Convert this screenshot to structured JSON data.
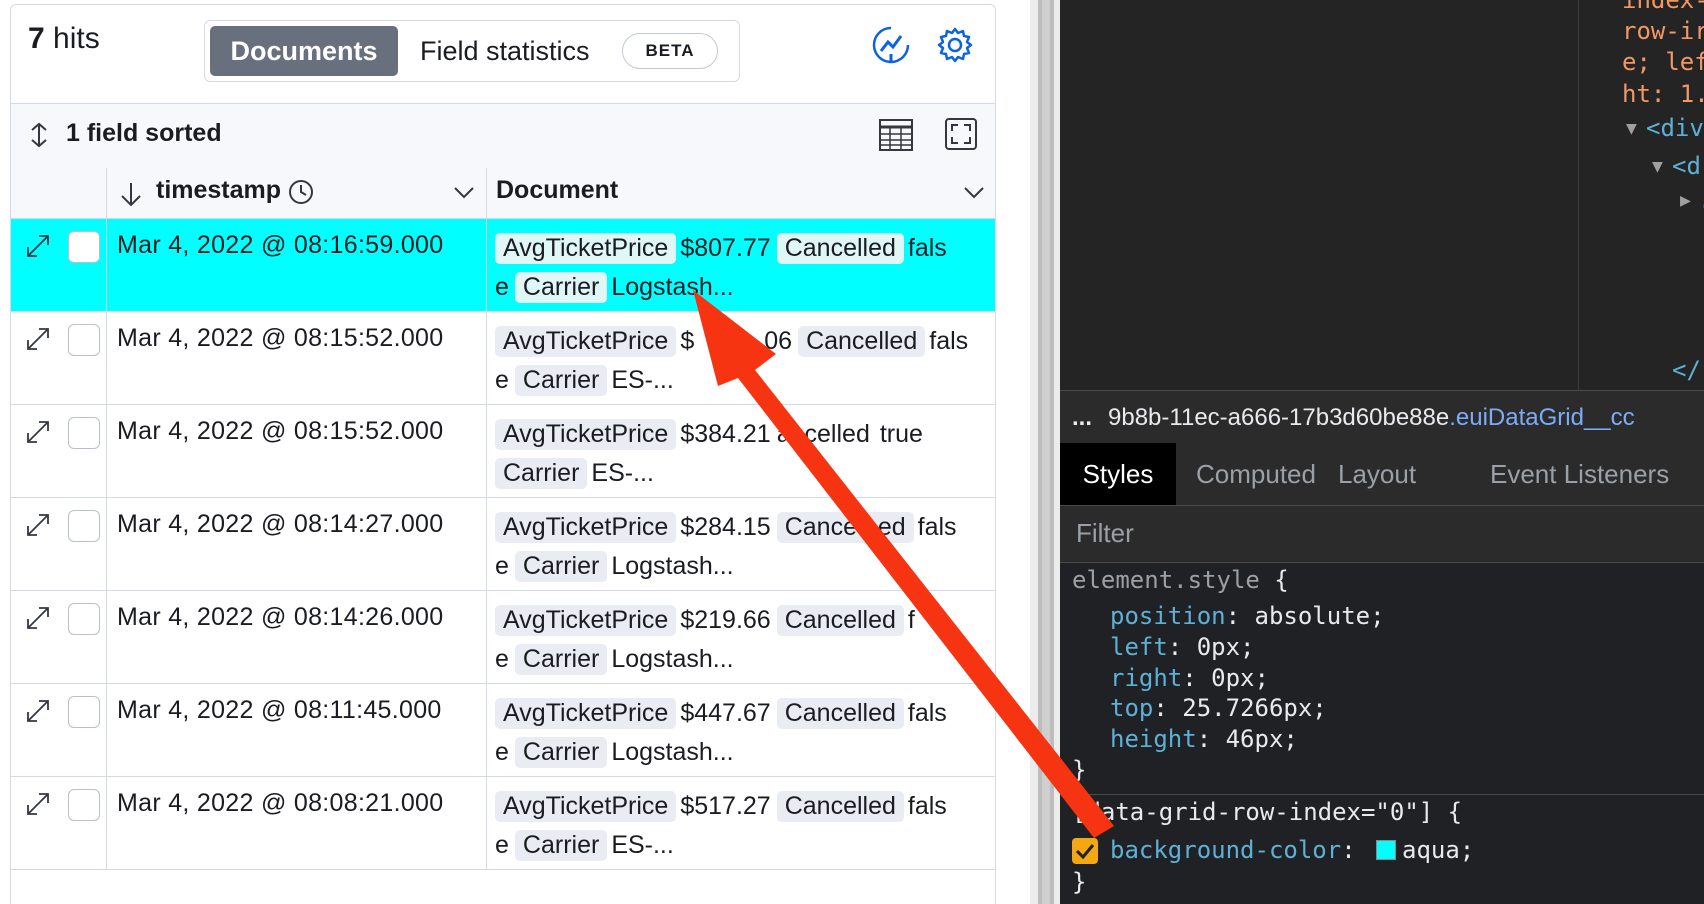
{
  "discover": {
    "hits_count": "7",
    "hits_label": "hits",
    "tabs": {
      "documents": "Documents",
      "field_statistics": "Field statistics",
      "beta": "BETA"
    },
    "toolbar": {
      "sort_label": "1 field sorted"
    },
    "columns": {
      "timestamp": "timestamp",
      "document": "Document"
    },
    "rows": [
      {
        "timestamp": "Mar 4, 2022 @ 08:16:59.000",
        "f1": "AvgTicketPrice",
        "v1": "$807.77",
        "f2": "Cancelled",
        "v2a": "fals",
        "v2b": "e",
        "f3": "Carrier",
        "v3": "Logstash...",
        "highlighted": true
      },
      {
        "timestamp": "Mar 4, 2022 @ 08:15:52.000",
        "f1": "AvgTicketPrice",
        "v1": "$",
        "v1b": "06",
        "f2": "Cancelled",
        "v2a": "fals",
        "v2b": "e",
        "f3": "Carrier",
        "v3": "ES-..."
      },
      {
        "timestamp": "Mar 4, 2022 @ 08:15:52.000",
        "f1": "AvgTicketPrice",
        "v1": "$384.21",
        "f2": "ancelled",
        "v2a": "true",
        "v2b": "",
        "f3": "Carrier",
        "v3": "ES-..."
      },
      {
        "timestamp": "Mar 4, 2022 @ 08:14:27.000",
        "f1": "AvgTicketPrice",
        "v1": "$284.15",
        "f2": "Cance   ed",
        "v2a": "fals",
        "v2b": "e",
        "f3": "Carrier",
        "v3": "Logstash..."
      },
      {
        "timestamp": "Mar 4, 2022 @ 08:14:26.000",
        "f1": "AvgTicketPrice",
        "v1": "$219.66",
        "f2": "Cancelled",
        "v2a": "f  s",
        "v2b": "e",
        "f3": "Carrier",
        "v3": "Logstash..."
      },
      {
        "timestamp": "Mar 4, 2022 @ 08:11:45.000",
        "f1": "AvgTicketPrice",
        "v1": "$447.67",
        "f2": "Cancelled",
        "v2a": "fals",
        "v2b": "e",
        "f3": "Carrier",
        "v3": "Logstash..."
      },
      {
        "timestamp": "Mar 4, 2022 @ 08:08:21.000",
        "f1": "AvgTicketPrice",
        "v1": "$517.27",
        "f2": "Cancelled",
        "v2a": "fals",
        "v2b": "e",
        "f3": "Carrier",
        "v3": "ES-..."
      }
    ]
  },
  "devtools": {
    "elements_lines": [
      {
        "text": "index-",
        "cls": "orange"
      },
      {
        "text": "row-ir",
        "cls": "orange"
      },
      {
        "text": "e; lef",
        "cls": "orange"
      },
      {
        "text": "ht: 1.",
        "cls": "orange"
      },
      {
        "text": "<div",
        "cls": "blue"
      },
      {
        "text": "<d",
        "cls": "blue"
      },
      {
        "text": ".",
        "cls": "blue"
      },
      {
        "text": "</",
        "cls": "blue"
      }
    ],
    "breadcrumb_prefix": "...",
    "breadcrumb_id": "9b8b-11ec-a666-17b3d60be88e",
    "breadcrumb_class": ".euiDataGrid__cc",
    "tabs": [
      "Styles",
      "Computed",
      "Layout",
      "Event Listeners"
    ],
    "filter_placeholder": "Filter",
    "element_style_selector": "element.style",
    "brace_open": "{",
    "brace_close": "}",
    "element_style_props": [
      {
        "name": "position",
        "value": "absolute;"
      },
      {
        "name": "left",
        "value": "0px;"
      },
      {
        "name": "right",
        "value": "0px;"
      },
      {
        "name": "top",
        "value": "25.7266px;"
      },
      {
        "name": "height",
        "value": "46px;"
      }
    ],
    "rule2_selector": "[data-grid-row-index=\"0\"] {",
    "rule2_prop": "background-color",
    "rule2_value": "aqua;",
    "colors": {
      "highlight": "#00ffff",
      "checkbox": "#f3a712",
      "arrow": "#f63411"
    }
  }
}
